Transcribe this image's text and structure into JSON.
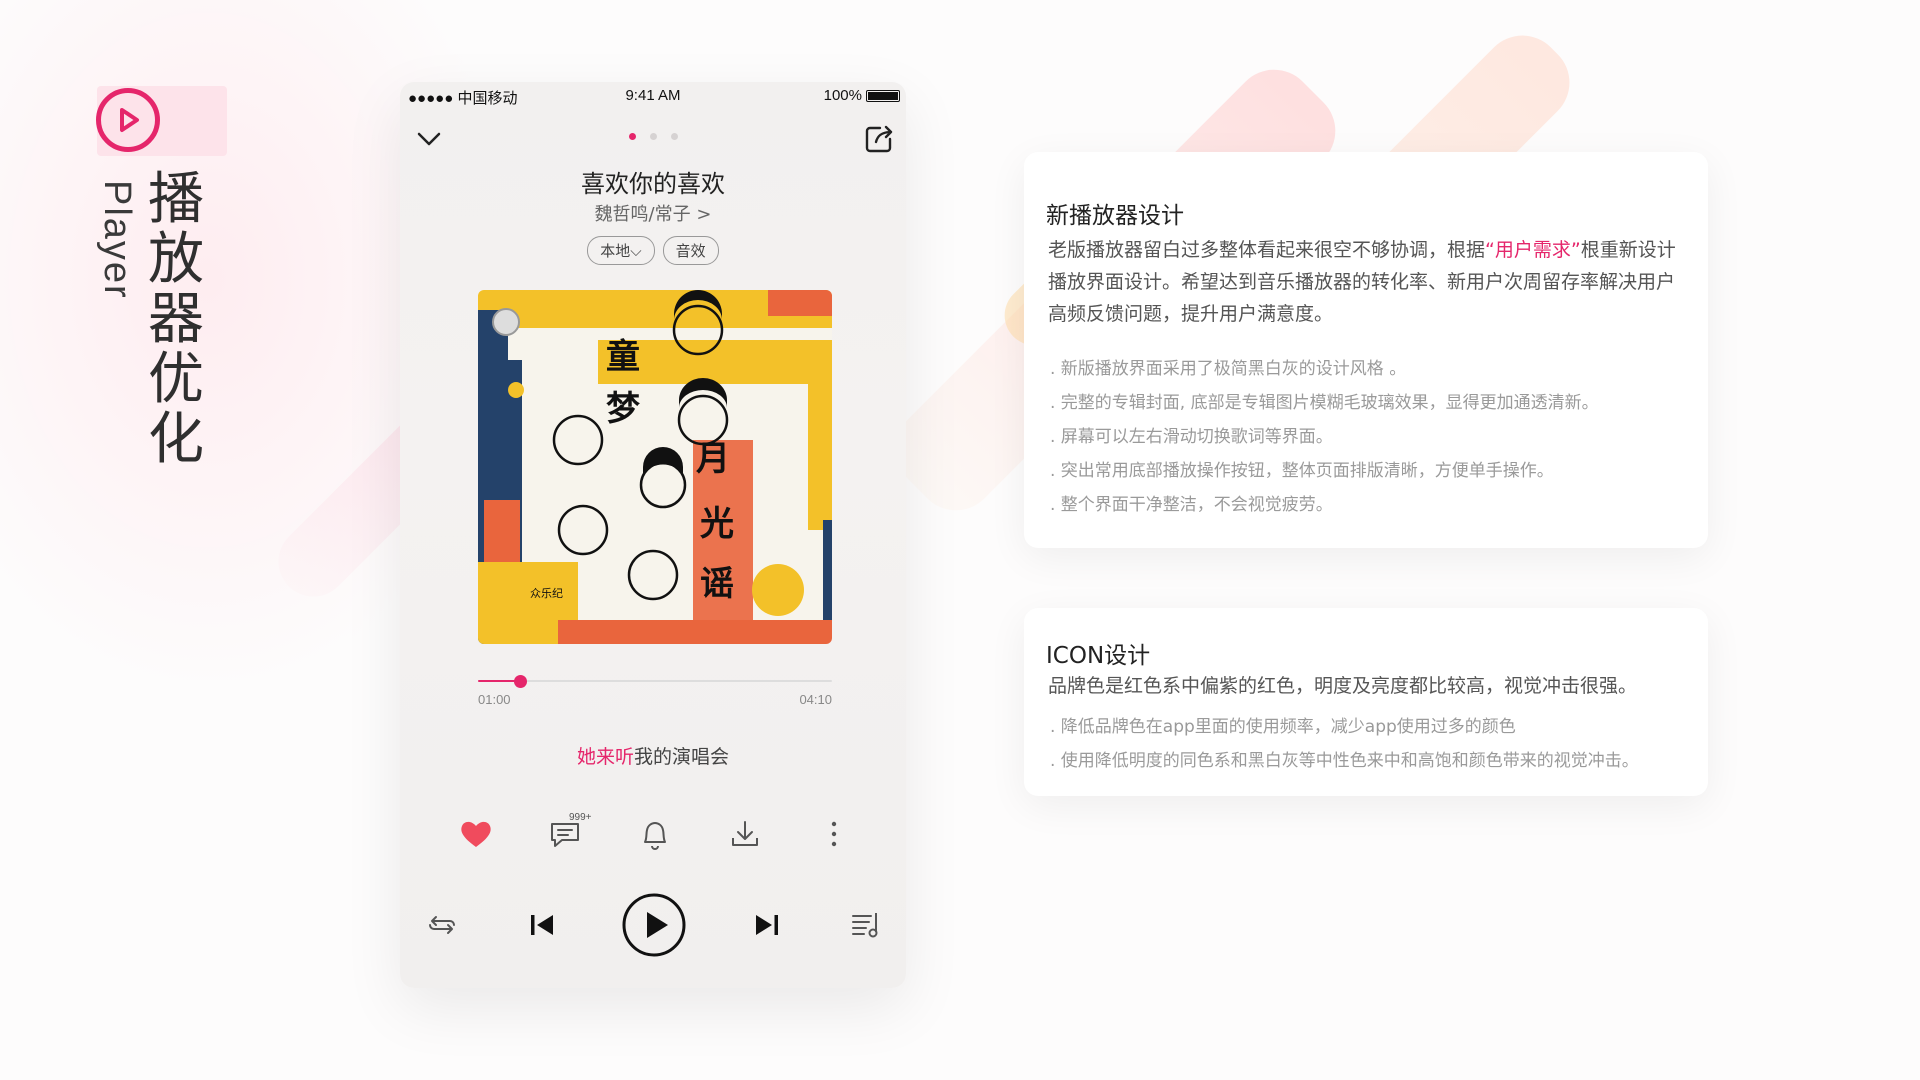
{
  "brand": {
    "accent": "#e5266b",
    "title_cn": "播放器优化",
    "title_en": "Player",
    "icon": "play-circle-icon"
  },
  "phone": {
    "status": {
      "carrier": "●●●●● 中国移动",
      "time": "9:41 AM",
      "battery": "100%"
    },
    "song_title": "喜欢你的喜欢",
    "artist": "魏哲鸣/常子 >",
    "tags": [
      "本地⌵",
      "音效"
    ],
    "progress": {
      "current": "01:00",
      "total": "04:10",
      "fraction": 0.12
    },
    "lyric_highlight": "她来听",
    "lyric_rest": "我的演唱会",
    "comment_badge": "999+",
    "cover_text": {
      "a": "童",
      "b": "梦",
      "c": "月",
      "d": "光",
      "e": "谣",
      "label": "众乐纪"
    },
    "action_icons": [
      "heart-icon",
      "comment-icon",
      "bell-icon",
      "download-icon",
      "more-icon"
    ],
    "control_icons": [
      "repeat-icon",
      "previous-icon",
      "play-icon",
      "next-icon",
      "playlist-icon"
    ]
  },
  "card1": {
    "title": "新播放器设计",
    "desc_before": "老版播放器留白过多整体看起来很空不够协调，根据",
    "desc_highlight": "“用户需求”",
    "desc_after": "根重新设计播放界面设计。希望达到音乐播放器的转化率、新用户次周留存率解决用户高频反馈问题，提升用户满意度。",
    "bullets": [
      ". 新版播放界面采用了极简黑白灰的设计风格 。",
      ". 完整的专辑封面, 底部是专辑图片模糊毛玻璃效果，显得更加通透清新。",
      ". 屏幕可以左右滑动切换歌词等界面。",
      ". 突出常用底部播放操作按钮，整体页面排版清晰，方便单手操作。",
      ". 整个界面干净整洁，不会视觉疲劳。"
    ]
  },
  "card2": {
    "title": "ICON设计",
    "desc": "品牌色是红色系中偏紫的红色，明度及亮度都比较高，视觉冲击很强。",
    "bullets": [
      ". 降低品牌色在app里面的使用频率，减少app使用过多的颜色",
      ". 使用降低明度的同色系和黑白灰等中性色来中和高饱和颜色带来的视觉冲击。"
    ]
  }
}
